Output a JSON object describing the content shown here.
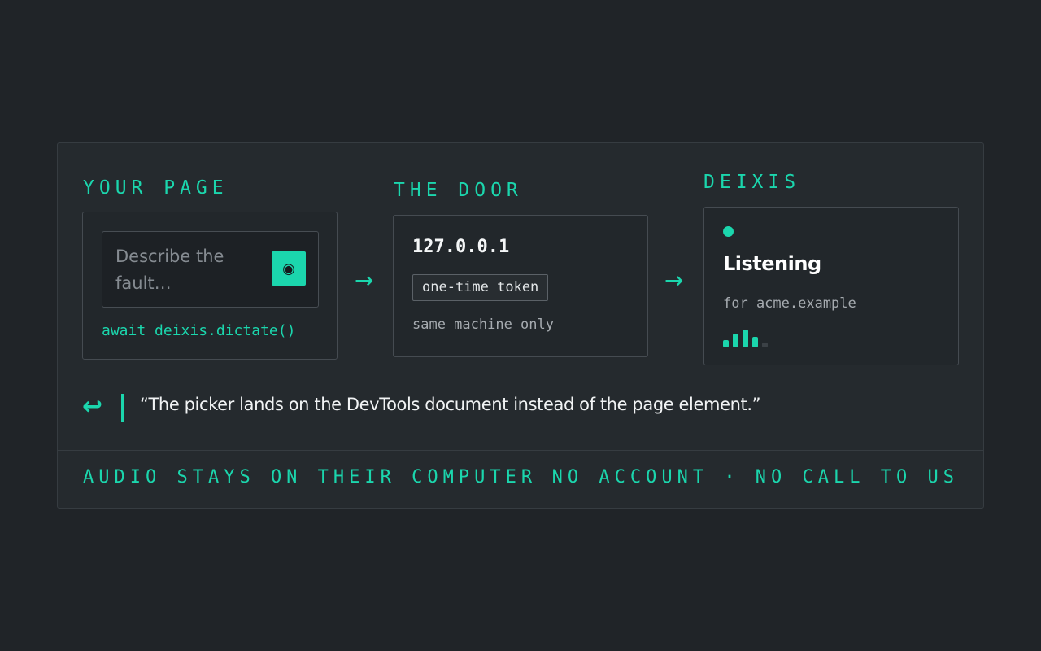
{
  "your_page": {
    "label": "YOUR PAGE",
    "input_placeholder": "Describe the fault…",
    "mic_icon": "record-icon",
    "code": "await deixis.dictate()"
  },
  "door": {
    "label": "THE DOOR",
    "address": "127.0.0.1",
    "token": "one-time token",
    "note": "same machine only"
  },
  "deixis": {
    "label": "DEIXIS",
    "status": "Listening",
    "host": "for acme.example",
    "level_icon": "audio-level-icon"
  },
  "arrows": [
    "→",
    "→"
  ],
  "quote": {
    "icon": "reply-icon",
    "text": "“The picker lands on the DevTools document instead of the page element.”"
  },
  "footer": {
    "left": "AUDIO STAYS ON THEIR COMPUTER",
    "right": "NO ACCOUNT · NO CALL TO US"
  },
  "colors": {
    "accent": "#1bd6ad",
    "background": "#202428",
    "panel": "#252a2e"
  }
}
